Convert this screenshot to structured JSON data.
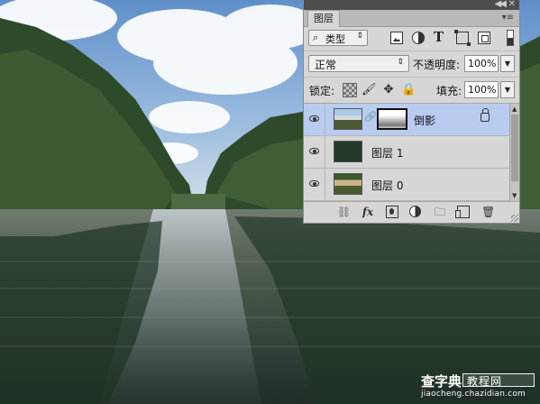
{
  "layers_panel": {
    "tab_label": "图层",
    "filter": {
      "kind_label": "类型"
    },
    "blend_mode": "正常",
    "opacity_label": "不透明度:",
    "opacity_value": "100%",
    "lock_label": "锁定:",
    "fill_label": "填充:",
    "fill_value": "100%",
    "layers": [
      {
        "name": "倒影",
        "selected": true,
        "visible": true,
        "locked": true,
        "has_mask": true
      },
      {
        "name": "图层 1",
        "selected": false,
        "visible": true
      },
      {
        "name": "图层 0",
        "selected": false,
        "visible": true
      }
    ],
    "bottom_icons": [
      "link-layers-icon",
      "fx-icon",
      "add-mask-icon",
      "adjustment-icon",
      "group-icon",
      "new-layer-icon",
      "delete-icon"
    ],
    "fx_label": "fx"
  },
  "watermark": {
    "brand": "查字典",
    "tutorial": "教程网",
    "url": "jiaocheng.chazidian.com"
  },
  "colors": {
    "selected_layer": "#b9cbef",
    "panel_bg": "#d6d6d6",
    "panel_topstrip": "#4d4d4d"
  }
}
